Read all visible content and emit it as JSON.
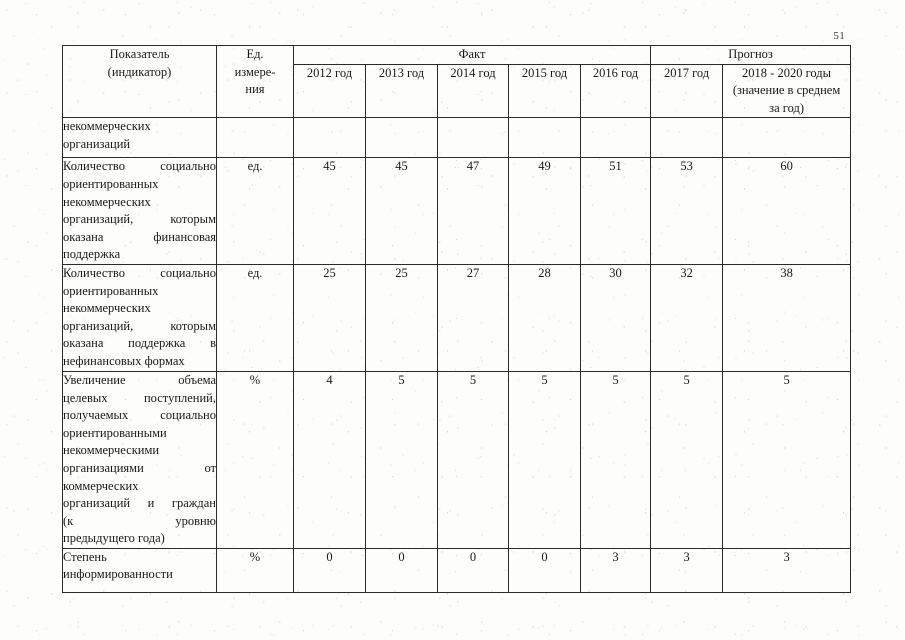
{
  "page": {
    "number": "51"
  },
  "table": {
    "header": {
      "indicator": [
        "Показатель",
        "(индикатор)"
      ],
      "unit": [
        "Ед.",
        "измере-",
        "ния"
      ],
      "group_fact": "Факт",
      "group_forecast": "Прогноз",
      "years": [
        "2012 год",
        "2013 год",
        "2014 год",
        "2015 год",
        "2016 год",
        "2017 год"
      ],
      "last_period": [
        "2018 - 2020 годы",
        "(значение в среднем",
        "за год)"
      ]
    },
    "rows": [
      {
        "indicator_lines": [
          "некоммерческих",
          "организаций"
        ],
        "justify": [
          false,
          false
        ],
        "unit": "",
        "values": [
          "",
          "",
          "",
          "",
          "",
          "",
          ""
        ]
      },
      {
        "indicator_lines": [
          "Количество социально",
          "ориентированных",
          "некоммерческих",
          "организаций, которым",
          "оказана финансовая",
          "поддержка"
        ],
        "justify": [
          true,
          false,
          false,
          true,
          true,
          false
        ],
        "unit": "ед.",
        "values": [
          "45",
          "45",
          "47",
          "49",
          "51",
          "53",
          "60"
        ]
      },
      {
        "indicator_lines": [
          "Количество социально",
          "ориентированных",
          "некоммерческих",
          "организаций, которым",
          "оказана поддержка в",
          "нефинансовых формах"
        ],
        "justify": [
          true,
          false,
          false,
          true,
          true,
          false
        ],
        "unit": "ед.",
        "values": [
          "25",
          "25",
          "27",
          "28",
          "30",
          "32",
          "38"
        ]
      },
      {
        "indicator_lines": [
          "Увеличение объема",
          "целевых поступлений,",
          "получаемых социально",
          "ориентированными",
          "некоммерческими",
          "организациями от",
          "коммерческих",
          "организаций и граждан",
          "(к уровню",
          "предыдущего года)"
        ],
        "justify": [
          true,
          true,
          true,
          false,
          false,
          true,
          false,
          true,
          true,
          false
        ],
        "unit": "%",
        "values": [
          "4",
          "5",
          "5",
          "5",
          "5",
          "5",
          "5"
        ]
      },
      {
        "indicator_lines": [
          "Степень",
          "информированности"
        ],
        "justify": [
          false,
          false
        ],
        "unit": "%",
        "values": [
          "0",
          "0",
          "0",
          "0",
          "3",
          "3",
          "3"
        ]
      }
    ]
  }
}
